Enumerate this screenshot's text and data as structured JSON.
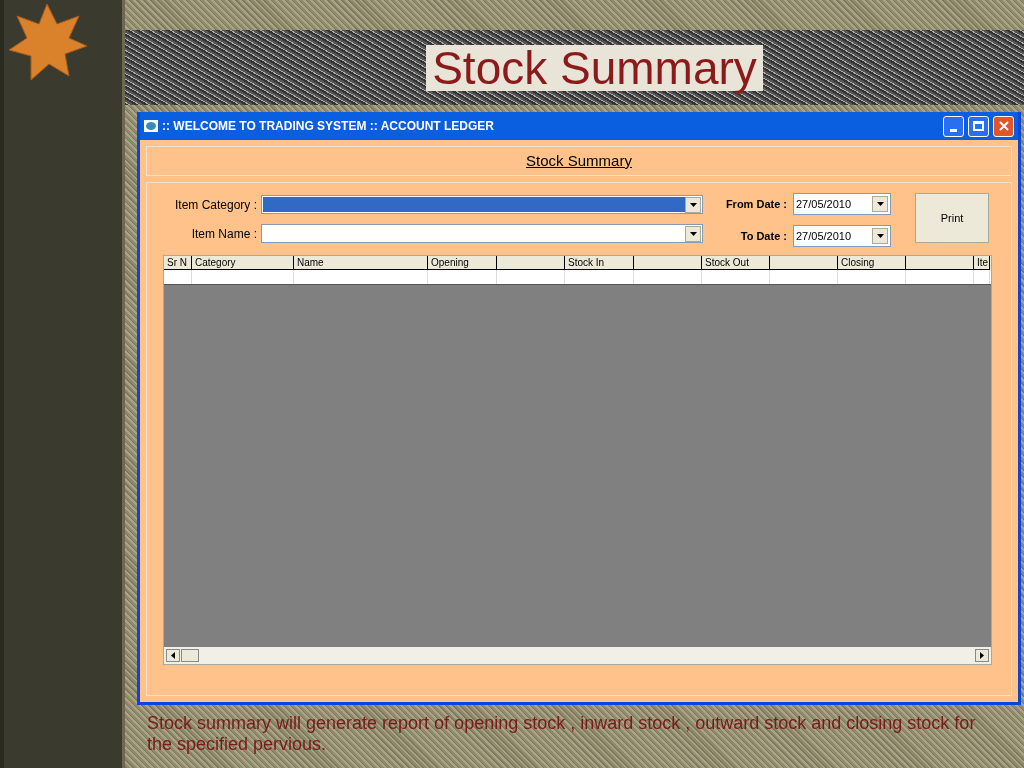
{
  "slide_title": "Stock Summary",
  "window": {
    "title": ":: WELCOME TO TRADING SYSTEM :: ACCOUNT LEDGER",
    "heading": "Stock Summary"
  },
  "form": {
    "item_category": {
      "label": "Item Category :"
    },
    "item_name": {
      "label": "Item Name :"
    },
    "from_date": {
      "label": "From Date :",
      "value": "27/05/2010"
    },
    "to_date": {
      "label": "To Date :",
      "value": "27/05/2010"
    },
    "print_button": "Print"
  },
  "table": {
    "columns": [
      {
        "kind": "text",
        "label": "Sr N"
      },
      {
        "kind": "text",
        "label": "Category"
      },
      {
        "kind": "text",
        "label": "Name"
      },
      {
        "kind": "text",
        "label": "Opening"
      },
      {
        "kind": "blank"
      },
      {
        "kind": "text",
        "label": "Stock In"
      },
      {
        "kind": "blank"
      },
      {
        "kind": "text",
        "label": "Stock Out"
      },
      {
        "kind": "blank"
      },
      {
        "kind": "text",
        "label": "Closing"
      },
      {
        "kind": "blank"
      },
      {
        "kind": "text",
        "label": "Ite"
      }
    ]
  },
  "caption": "Stock summary will generate report of opening stock , inward stock , outward stock and closing stock  for the specified pervious."
}
